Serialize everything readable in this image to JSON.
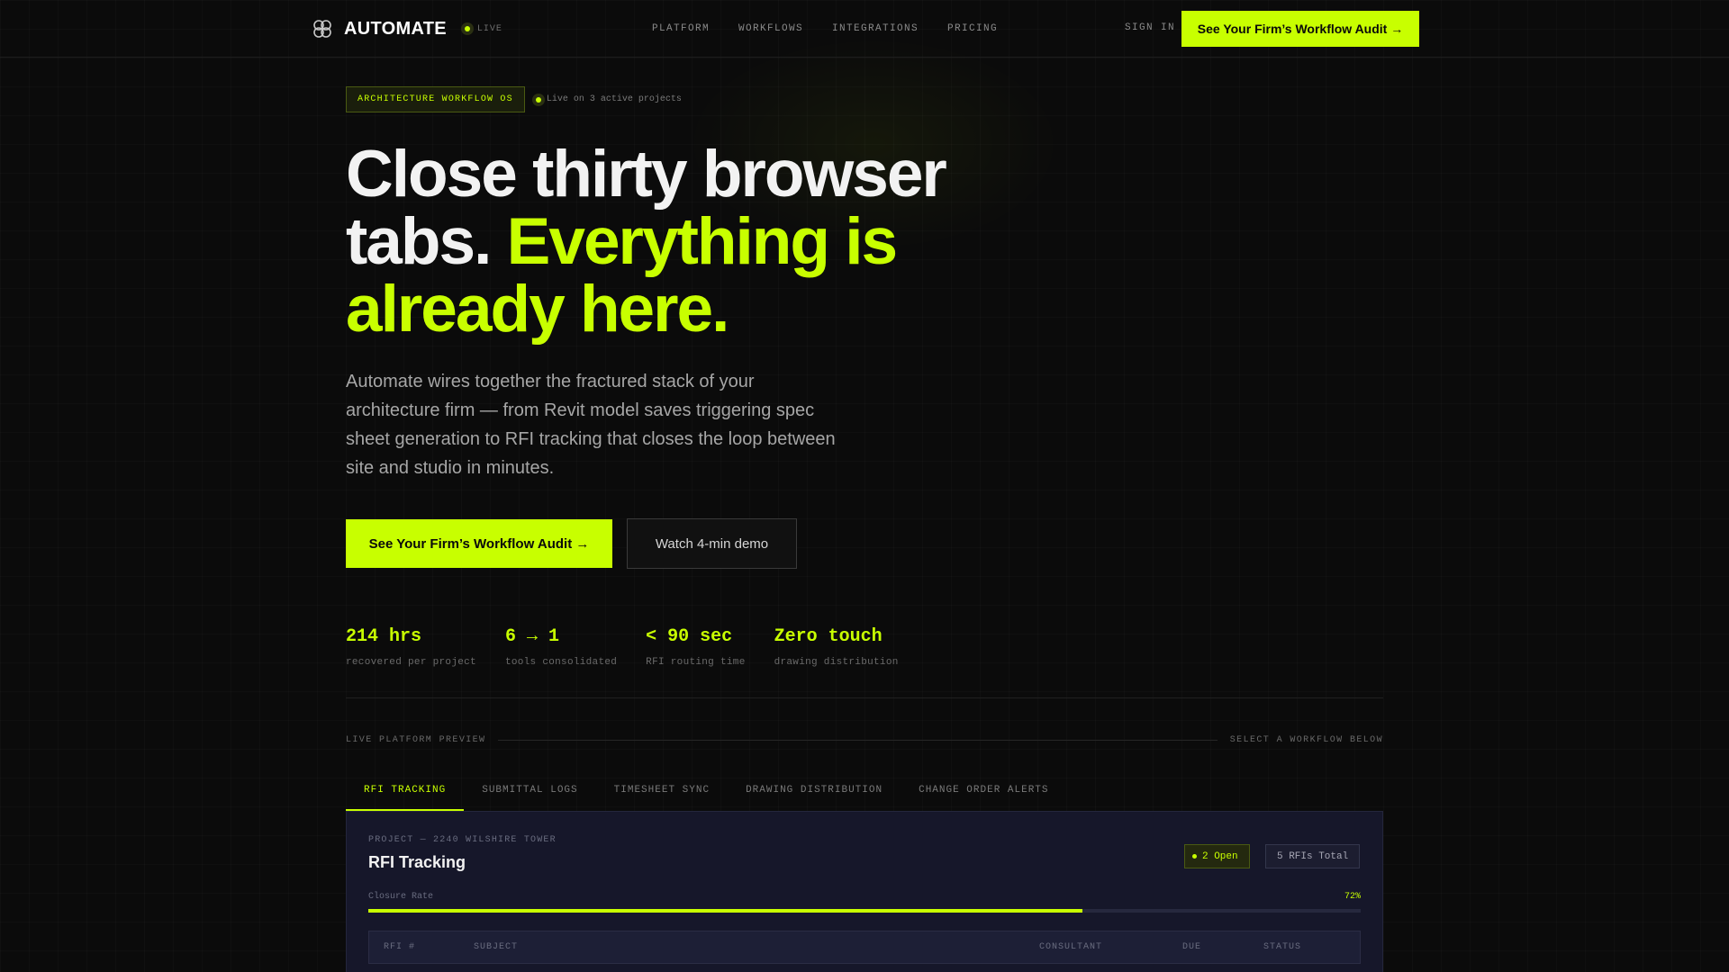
{
  "nav": {
    "brand": "AUTOMATE",
    "live_label": "LIVE",
    "links": [
      "PLATFORM",
      "WORKFLOWS",
      "INTEGRATIONS",
      "PRICING"
    ],
    "sign_in": "SIGN IN",
    "cta": "See Your Firm’s Workflow Audit →"
  },
  "hero": {
    "badge": "ARCHITECTURE WORKFLOW OS",
    "badge_note": "Live on 3 active projects",
    "headline_plain": "Close thirty browser tabs. ",
    "headline_accent": "Everything is already here.",
    "lede": "Automate wires together the fractured stack of your architecture firm — from Revit model saves triggering spec sheet generation to RFI tracking that closes the loop between site and studio in minutes.",
    "primary_cta": "See Your Firm’s Workflow Audit →",
    "secondary_cta": "Watch 4-min demo"
  },
  "stats": [
    {
      "value": "214 hrs",
      "label": "recovered per project"
    },
    {
      "value": "6 → 1",
      "label": "tools consolidated"
    },
    {
      "value": "< 90 sec",
      "label": "RFI routing time"
    },
    {
      "value": "Zero touch",
      "label": "drawing distribution"
    }
  ],
  "preview": {
    "left_label": "LIVE PLATFORM PREVIEW",
    "right_label": "SELECT A WORKFLOW BELOW",
    "tabs": [
      "RFI TRACKING",
      "SUBMITTAL LOGS",
      "TIMESHEET SYNC",
      "DRAWING DISTRIBUTION",
      "CHANGE ORDER ALERTS"
    ],
    "active_tab": 0
  },
  "panel": {
    "eyebrow": "PROJECT — 2240 WILSHIRE TOWER",
    "title": "RFI Tracking",
    "open_chip": "2 Open",
    "total_chip": "5 RFIs Total",
    "closure_label": "Closure Rate",
    "closure_pct_text": "72%",
    "closure_value": 0.72,
    "columns": [
      "RFI #",
      "SUBJECT",
      "CONSULTANT",
      "DUE",
      "STATUS"
    ]
  },
  "colors": {
    "accent": "#c8ff00",
    "background": "#0b0b0b",
    "panel": "#16172a"
  }
}
